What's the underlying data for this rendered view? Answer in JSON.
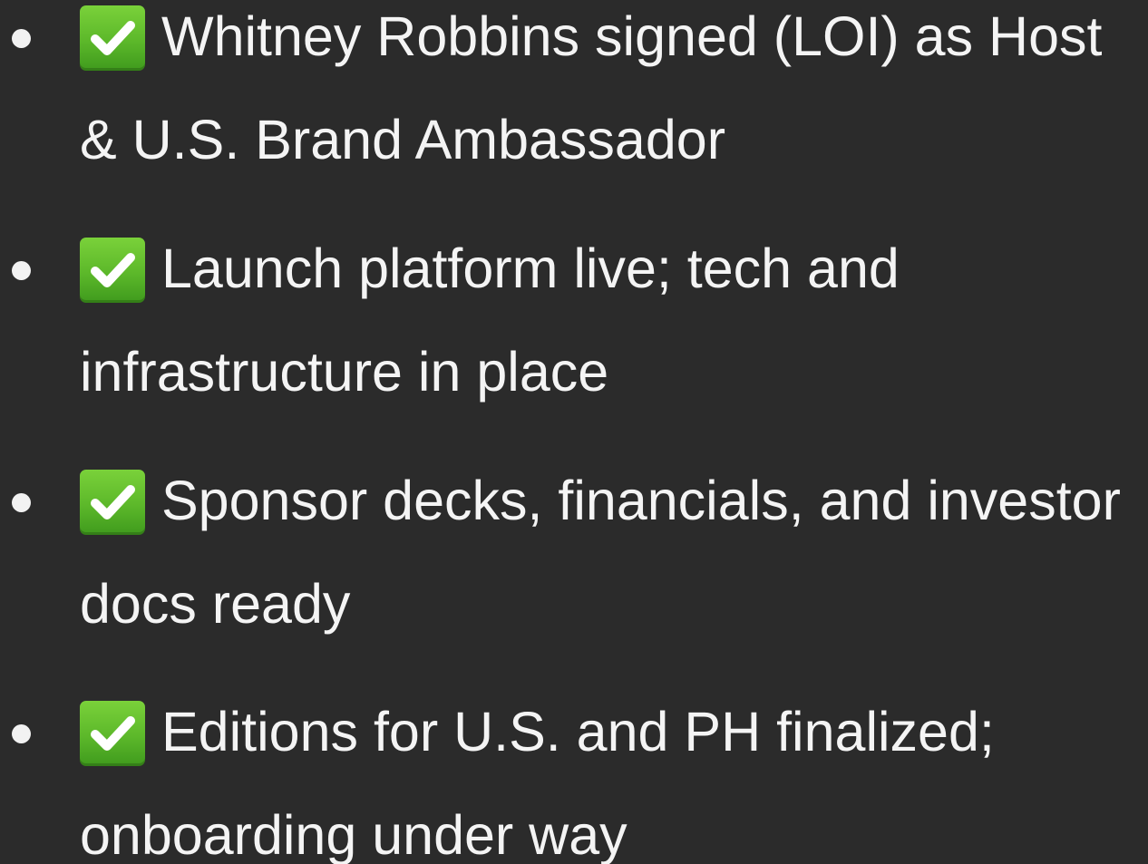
{
  "icon": "check-mark-button-icon",
  "accent": "#5cb82a",
  "items": [
    {
      "text": "Whitney Robbins signed (LOI) as Host & U.S. Brand Ambassador"
    },
    {
      "text": "Launch platform live; tech and infrastructure in place"
    },
    {
      "text": "Sponsor decks, financials, and investor docs ready"
    },
    {
      "text": "Editions for U.S. and PH finalized; onboarding under way"
    }
  ]
}
